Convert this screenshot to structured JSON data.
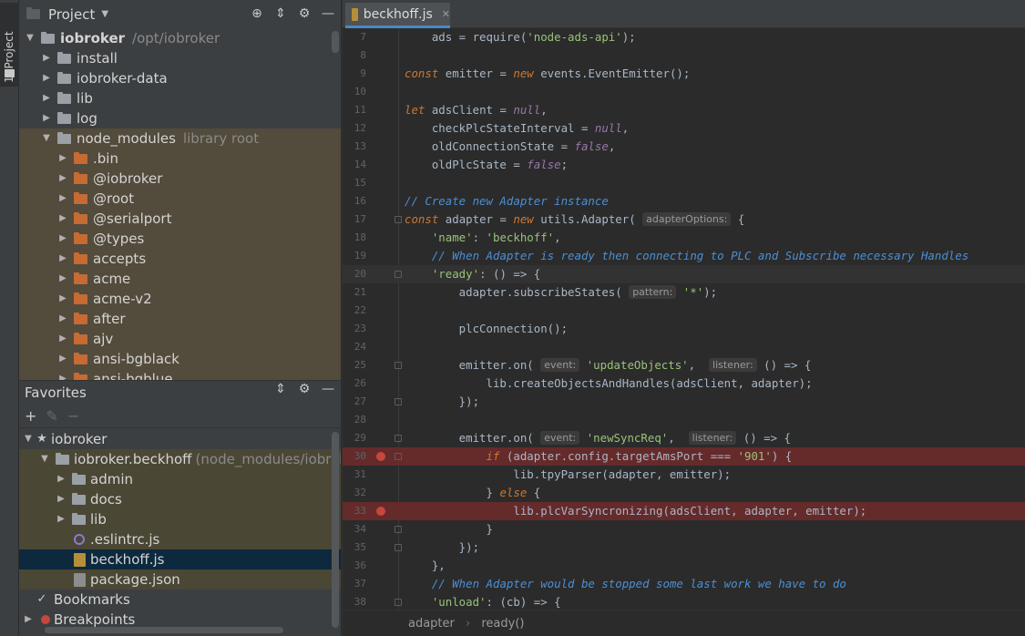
{
  "tool_strip": {
    "label": "1: Project"
  },
  "project_panel": {
    "title": "Project",
    "tree": [
      {
        "label": "iobroker",
        "hint": "/opt/iobroker",
        "bold": true,
        "expanded": true,
        "indent": 0
      },
      {
        "label": "install",
        "indent": 1
      },
      {
        "label": "iobroker-data",
        "indent": 1
      },
      {
        "label": "lib",
        "indent": 1
      },
      {
        "label": "log",
        "indent": 1
      },
      {
        "label": "node_modules",
        "hint": "library root",
        "expanded": true,
        "indent": 1,
        "library": true
      },
      {
        "label": ".bin",
        "indent": 2,
        "library": true
      },
      {
        "label": "@iobroker",
        "indent": 2,
        "library": true
      },
      {
        "label": "@root",
        "indent": 2,
        "library": true
      },
      {
        "label": "@serialport",
        "indent": 2,
        "library": true
      },
      {
        "label": "@types",
        "indent": 2,
        "library": true
      },
      {
        "label": "accepts",
        "indent": 2,
        "library": true
      },
      {
        "label": "acme",
        "indent": 2,
        "library": true
      },
      {
        "label": "acme-v2",
        "indent": 2,
        "library": true
      },
      {
        "label": "after",
        "indent": 2,
        "library": true
      },
      {
        "label": "ajv",
        "indent": 2,
        "library": true
      },
      {
        "label": "ansi-bgblack",
        "indent": 2,
        "library": true
      },
      {
        "label": "ansi-bgblue",
        "indent": 2,
        "library": true
      }
    ]
  },
  "favorites_panel": {
    "title": "Favorites",
    "tree": [
      {
        "label": "iobroker",
        "kind": "star",
        "indent": 0
      },
      {
        "label": "iobroker.beckhoff",
        "hint": "(node_modules/iobroker",
        "kind": "folder",
        "indent": 1,
        "fav": true
      },
      {
        "label": "admin",
        "kind": "folder",
        "indent": 2,
        "fav": true
      },
      {
        "label": "docs",
        "kind": "folder",
        "indent": 2,
        "fav": true
      },
      {
        "label": "lib",
        "kind": "folder",
        "indent": 2,
        "fav": true
      },
      {
        "label": ".eslintrc.js",
        "kind": "eslint",
        "indent": 2,
        "fav": true
      },
      {
        "label": "beckhoff.js",
        "kind": "js",
        "indent": 2,
        "selected": true
      },
      {
        "label": "package.json",
        "kind": "json",
        "indent": 2,
        "fav": true
      },
      {
        "label": "Bookmarks",
        "kind": "check",
        "indent": 0
      },
      {
        "label": "Breakpoints",
        "kind": "breakpoint",
        "indent": 0
      }
    ]
  },
  "editor": {
    "tab_label": "beckhoff.js",
    "lines": [
      {
        "n": "7",
        "html": "    ads = require(<span class=\"str\">'node-ads-api'</span>);"
      },
      {
        "n": "8",
        "html": ""
      },
      {
        "n": "9",
        "html": "<span class=\"kw\">const</span> emitter = <span class=\"kw\">new</span> events.EventEmitter();"
      },
      {
        "n": "10",
        "html": ""
      },
      {
        "n": "11",
        "html": "<span class=\"kw\">let</span> adsClient = <span class=\"nul\">null</span>,"
      },
      {
        "n": "12",
        "html": "    checkPlcStateInterval = <span class=\"nul\">null</span>,"
      },
      {
        "n": "13",
        "html": "    oldConnectionState = <span class=\"nul\">false</span>,"
      },
      {
        "n": "14",
        "html": "    oldPlcState = <span class=\"nul\">false</span>;"
      },
      {
        "n": "15",
        "html": ""
      },
      {
        "n": "16",
        "html": "<span class=\"cm\">// Create new Adapter instance</span>"
      },
      {
        "n": "17",
        "html": "<span class=\"kw\">const</span> adapter = <span class=\"kw\">new</span> utils.Adapter( <span class=\"prm\">adapterOptions:</span> {",
        "fold": true
      },
      {
        "n": "18",
        "html": "    <span class=\"str\">'name'</span>: <span class=\"str\">'beckhoff'</span>,"
      },
      {
        "n": "19",
        "html": "    <span class=\"cm\">// When Adapter is ready then connecting to PLC and Subscribe necessary Handles</span>"
      },
      {
        "n": "20",
        "html": "    <span class=\"str\">'ready'</span>: () => {",
        "fold": true,
        "current": true
      },
      {
        "n": "21",
        "html": "        adapter.subscribeStates( <span class=\"prm\">pattern:</span> <span class=\"str\">'*'</span>);"
      },
      {
        "n": "22",
        "html": ""
      },
      {
        "n": "23",
        "html": "        plcConnection();"
      },
      {
        "n": "24",
        "html": ""
      },
      {
        "n": "25",
        "html": "        emitter.on( <span class=\"prm\">event:</span> <span class=\"str\">'updateObjects'</span>,  <span class=\"prm\">listener:</span> () => {",
        "fold": true
      },
      {
        "n": "26",
        "html": "            lib.createObjectsAndHandles(adsClient, adapter);"
      },
      {
        "n": "27",
        "html": "        });",
        "fold": true
      },
      {
        "n": "28",
        "html": ""
      },
      {
        "n": "29",
        "html": "        emitter.on( <span class=\"prm\">event:</span> <span class=\"str\">'newSyncReq'</span>,  <span class=\"prm\">listener:</span> () => {",
        "fold": true
      },
      {
        "n": "30",
        "html": "            <span class=\"kw\">if</span> (adapter.config.targetAmsPort === <span class=\"str\">'901'</span>) {",
        "fold": true,
        "breakpoint": true
      },
      {
        "n": "31",
        "html": "                lib.tpyParser(adapter, emitter);"
      },
      {
        "n": "32",
        "html": "            } <span class=\"kw\">else</span> {"
      },
      {
        "n": "33",
        "html": "                lib.plcVarSyncronizing(adsClient, adapter, emitter);",
        "breakpoint": true
      },
      {
        "n": "34",
        "html": "            }",
        "fold": true
      },
      {
        "n": "35",
        "html": "        });",
        "fold": true
      },
      {
        "n": "36",
        "html": "    },"
      },
      {
        "n": "37",
        "html": "    <span class=\"cm\">// When Adapter would be stopped some last work we have to do</span>"
      },
      {
        "n": "38",
        "html": "    <span class=\"str\">'unload'</span>: (cb) => {",
        "fold": true
      }
    ],
    "breadcrumbs": [
      "adapter",
      "ready()"
    ]
  },
  "colors": {
    "accent": "#4a88c7",
    "breakpoint_line": "#652a2a",
    "library_row": "#534b3b",
    "selected_row": "#0d293e"
  }
}
